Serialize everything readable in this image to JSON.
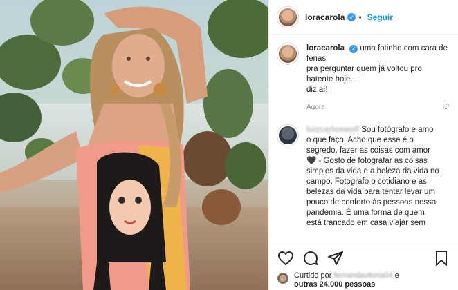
{
  "post": {
    "username": "loracarola",
    "follow_label": "Seguir",
    "dot": "•"
  },
  "caption": {
    "username": "loracarola",
    "lines": [
      "uma fotinho com cara de",
      "férias",
      "pra perguntar quem já voltou pro",
      "batente hoje...",
      "diz aí!"
    ],
    "time": "Agora"
  },
  "comment": {
    "username": "luizcarloswolf",
    "text": "Sou fotógrafo e amo o que faço. Acho que esse é o segredo, fazer as coisas com amor 🖤 - Gosto de fotografar as coisas simples da vida e a beleza da vida no campo. Fotografo o cotidiano e as belezas da vida para tentar levar um pouco de conforto às pessoas nessa pandemia. É uma forma de quem está trancado em casa viajar sem"
  },
  "likes": {
    "prefix": "Curtido por",
    "blurred_user": "fernandavitoria04",
    "suffix_connector": "e",
    "others": "outras 24.000 pessoas"
  },
  "colors": {
    "accent": "#0095f6",
    "verified": "#3897f0",
    "text": "#262626",
    "muted": "#8e8e8e"
  },
  "icons": [
    "verified-badge-icon",
    "heart-icon",
    "comment-icon",
    "share-icon",
    "bookmark-icon"
  ]
}
